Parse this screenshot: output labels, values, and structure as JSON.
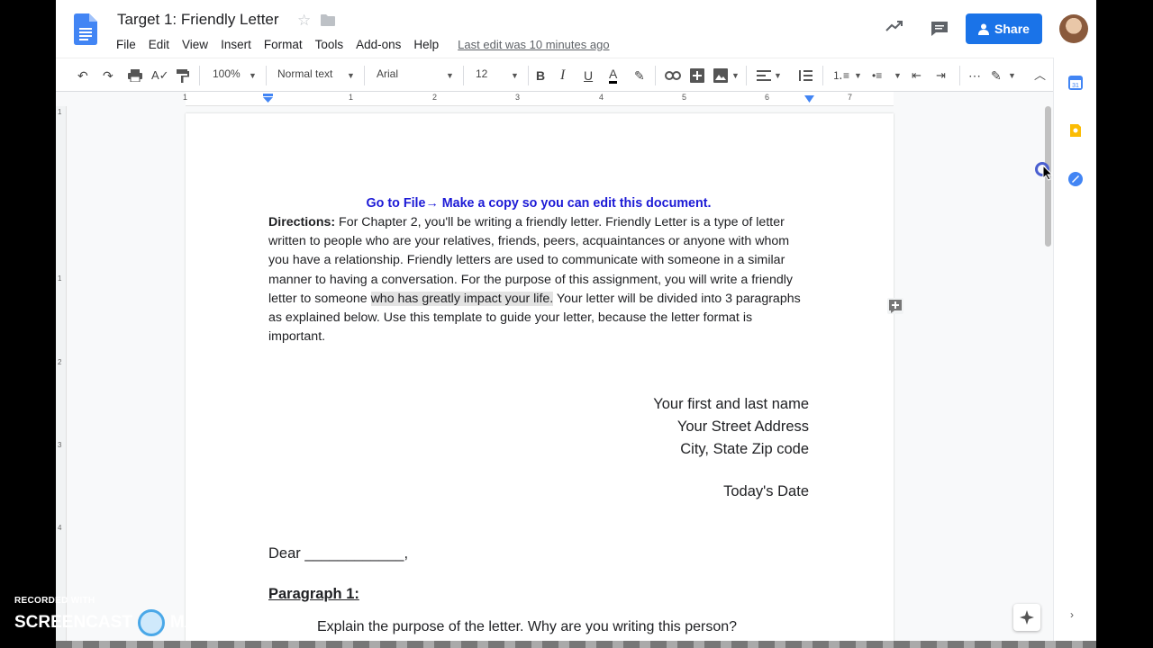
{
  "doc": {
    "title": "Target 1: Friendly Letter",
    "last_edit": "Last edit was 10 minutes ago"
  },
  "menu": [
    "File",
    "Edit",
    "View",
    "Insert",
    "Format",
    "Tools",
    "Add-ons",
    "Help"
  ],
  "toolbar": {
    "zoom": "100%",
    "style": "Normal text",
    "font": "Arial",
    "size": "12"
  },
  "share_label": "Share",
  "ruler_labels": [
    "1",
    "1",
    "2",
    "3",
    "4",
    "5",
    "6",
    "7"
  ],
  "left_ruler_labels": [
    "1",
    "1",
    "2",
    "3",
    "4"
  ],
  "body": {
    "heading": "Go to File→ Make a copy so you can edit this document.",
    "directions_label": "Directions:",
    "directions_text": " For Chapter 2, you'll be writing a friendly letter. Friendly Letter is a type of letter written to people who are your relatives, friends, peers, acquaintances or anyone with whom you have a relationship.  Friendly letters are used to communicate with someone in a similar manner to having a conversation. For the purpose of this assignment, you will write a friendly letter to someone ",
    "directions_highlight": "who has greatly impact your life.",
    "directions_tail": " Your letter will be divided into 3 paragraphs as explained below. Use this template to guide your letter, because the letter format is important.",
    "address": [
      "Your first and last name",
      "Your Street Address",
      "City, State Zip code"
    ],
    "date": "Today's Date",
    "dear": "Dear ____________,",
    "para1": "Paragraph 1:",
    "next_line": "Explain the purpose of the letter. Why are you writing this person?"
  },
  "watermark": {
    "top": "RECORDED WITH",
    "left": "SCREENCAST",
    "right": "MATIC"
  },
  "colors": {
    "accent": "#1a73e8",
    "heading": "#1c1ad6",
    "highlight": "#e3e3e3"
  }
}
